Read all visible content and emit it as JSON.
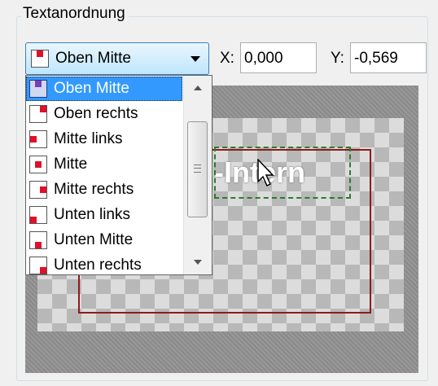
{
  "group": {
    "title": "Textanordnung"
  },
  "combo": {
    "selected_label": "Oben Mitte",
    "selected_icon": "position-top-center-icon"
  },
  "coords": {
    "x_label": "X:",
    "x_value": "0,000",
    "y_label": "Y:",
    "y_value": "-0,569"
  },
  "dropdown": {
    "items": [
      {
        "label": "Oben Mitte",
        "icon": "position-top-center-icon"
      },
      {
        "label": "Oben rechts",
        "icon": "position-top-right-icon"
      },
      {
        "label": "Mitte links",
        "icon": "position-middle-left-icon"
      },
      {
        "label": "Mitte",
        "icon": "position-middle-center-icon"
      },
      {
        "label": "Mitte rechts",
        "icon": "position-middle-right-icon"
      },
      {
        "label": "Unten links",
        "icon": "position-bottom-left-icon"
      },
      {
        "label": "Unten Mitte",
        "icon": "position-bottom-center-icon"
      },
      {
        "label": "Unten rechts",
        "icon": "position-bottom-right-icon"
      }
    ],
    "selected_index": 0
  },
  "preview": {
    "text": "-Intern"
  },
  "colors": {
    "accent": "#3399ff",
    "marker": "#e0102a",
    "frame": "#8c1c1c",
    "text_box": "#2d7a2d"
  }
}
